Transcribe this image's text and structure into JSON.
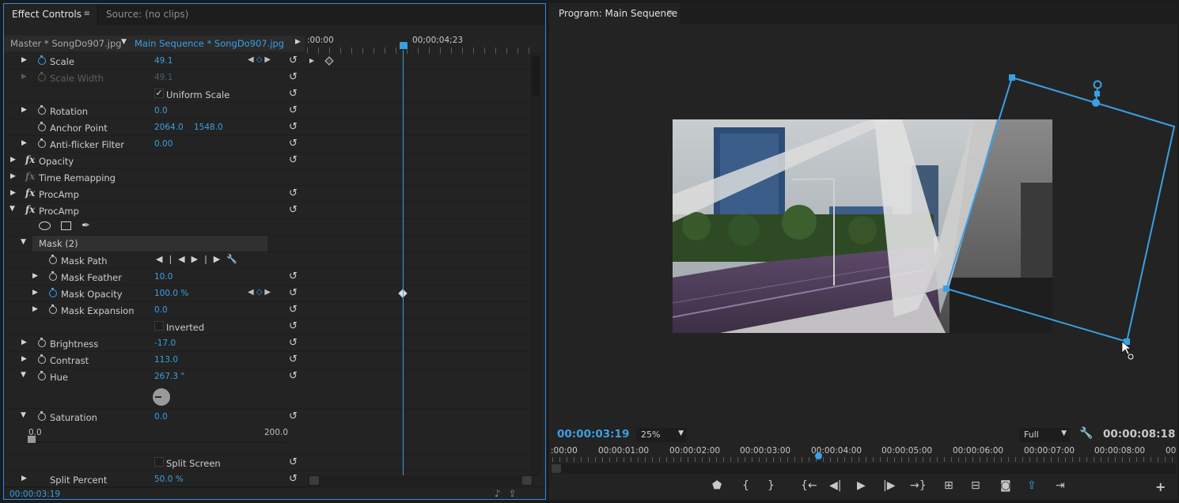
{
  "left_panel": {
    "tabs": [
      {
        "label": "Effect Controls",
        "menu": "≡"
      },
      {
        "label": "Source: (no clips)"
      }
    ],
    "clip_master": "Master * SongDo907.jpg",
    "clip_sequence": "Main Sequence * SongDo907.jpg",
    "ruler": {
      "start": ":00:00",
      "marker": "00;00;04;23"
    },
    "properties": [
      {
        "label": "Scale",
        "value": "49.1"
      },
      {
        "label": "Scale Width",
        "value": "49.1"
      },
      {
        "label": "Uniform Scale"
      },
      {
        "label": "Rotation",
        "value": "0.0"
      },
      {
        "label": "Anchor Point",
        "value": "2064.0",
        "value2": "1548.0"
      },
      {
        "label": "Anti-flicker Filter",
        "value": "0.00"
      },
      {
        "label": "Opacity"
      },
      {
        "label": "Time Remapping"
      },
      {
        "label": "ProcAmp"
      },
      {
        "label": "ProcAmp"
      },
      {
        "label": "Mask (2)"
      },
      {
        "label": "Mask Path"
      },
      {
        "label": "Mask Feather",
        "value": "10.0"
      },
      {
        "label": "Mask Opacity",
        "value": "100.0 %"
      },
      {
        "label": "Mask Expansion",
        "value": "0.0"
      },
      {
        "label": "Inverted"
      },
      {
        "label": "Brightness",
        "value": "-17.0"
      },
      {
        "label": "Contrast",
        "value": "113.0"
      },
      {
        "label": "Hue",
        "value": "267.3 °"
      },
      {
        "label": "Saturation",
        "value": "0.0"
      },
      {
        "label": "Split Screen"
      },
      {
        "label": "Split Percent",
        "value": "50.0 %"
      }
    ],
    "saturation_range": {
      "min": "0.0",
      "max": "200.0",
      "level": 0
    },
    "fx_glyph": "fx",
    "status_time": "00:00:03:19"
  },
  "right_panel": {
    "tab": {
      "label": "Program: Main Sequence",
      "menu": "≡"
    },
    "time_current": "00:00:03:19",
    "zoom": "25%",
    "quality": "Full",
    "time_duration": "00:00:08:18",
    "ruler_labels": [
      ":00:00",
      "00:00:01:00",
      "00:00:02:00",
      "00:00:03:00",
      "00:00:04:00",
      "00:00:05:00",
      "00:00:06:00",
      "00:00:07:00",
      "00:00:08:00",
      "00"
    ]
  },
  "colors": {
    "accent": "#3aa0e3",
    "panel": "#232323",
    "background": "#1b1b1b"
  }
}
